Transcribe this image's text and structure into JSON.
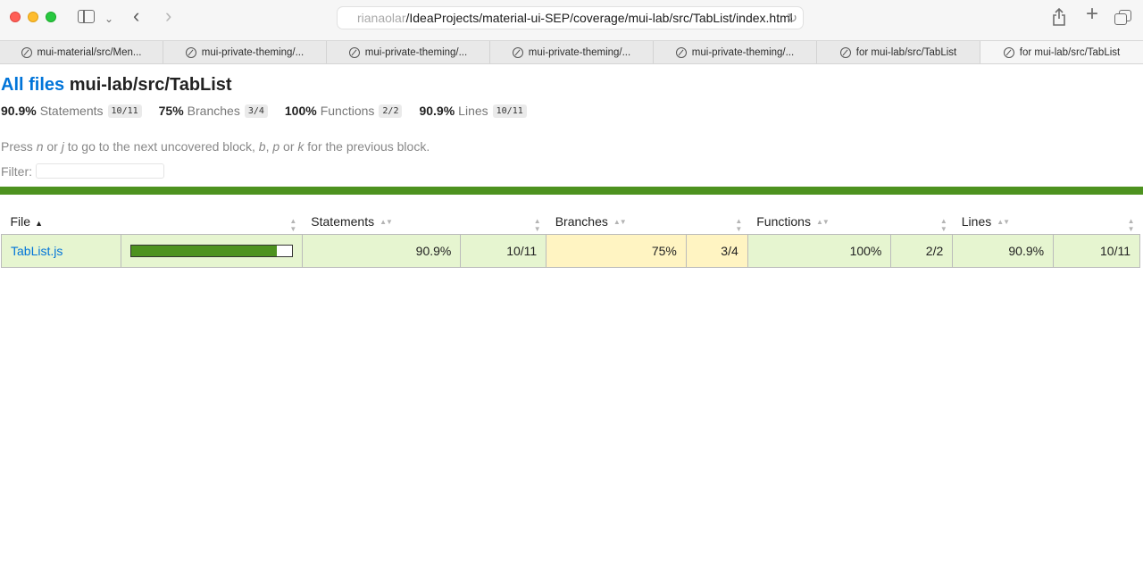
{
  "browser": {
    "url_prefix": "rianaolar",
    "url_main": "/IdeaProjects/material-ui-SEP/coverage/mui-lab/src/TabList/index.html",
    "tabs": [
      {
        "label": "mui-material/src/Men..."
      },
      {
        "label": "mui-private-theming/..."
      },
      {
        "label": "mui-private-theming/..."
      },
      {
        "label": "mui-private-theming/..."
      },
      {
        "label": "mui-private-theming/..."
      },
      {
        "label": "for mui-lab/src/TabList"
      },
      {
        "label": "for mui-lab/src/TabList"
      }
    ]
  },
  "page": {
    "all_files_link": "All files",
    "path": "mui-lab/src/TabList",
    "summary": [
      {
        "pct": "90.9%",
        "label": "Statements",
        "fraction": "10/11"
      },
      {
        "pct": "75%",
        "label": "Branches",
        "fraction": "3/4"
      },
      {
        "pct": "100%",
        "label": "Functions",
        "fraction": "2/2"
      },
      {
        "pct": "90.9%",
        "label": "Lines",
        "fraction": "10/11"
      }
    ],
    "hint": {
      "t1": "Press ",
      "k1": "n",
      "t2": " or ",
      "k2": "j",
      "t3": " to go to the next uncovered block, ",
      "k3": "b",
      "t4": ", ",
      "k4": "p",
      "t5": " or ",
      "k5": "k",
      "t6": " for the previous block."
    },
    "filter_label": "Filter:",
    "filter_value": ""
  },
  "table": {
    "headers": {
      "file": "File",
      "statements": "Statements",
      "branches": "Branches",
      "functions": "Functions",
      "lines": "Lines"
    },
    "rows": [
      {
        "file": "TabList.js",
        "coverage_fraction": 0.909,
        "statements_pct": "90.9%",
        "statements_frac": "10/11",
        "branches_pct": "75%",
        "branches_frac": "3/4",
        "functions_pct": "100%",
        "functions_frac": "2/2",
        "lines_pct": "90.9%",
        "lines_frac": "10/11"
      }
    ]
  },
  "colors": {
    "high": "#e6f5d0",
    "medium": "#fff4c2",
    "bar": "#4d921f",
    "link": "#0074d9"
  }
}
